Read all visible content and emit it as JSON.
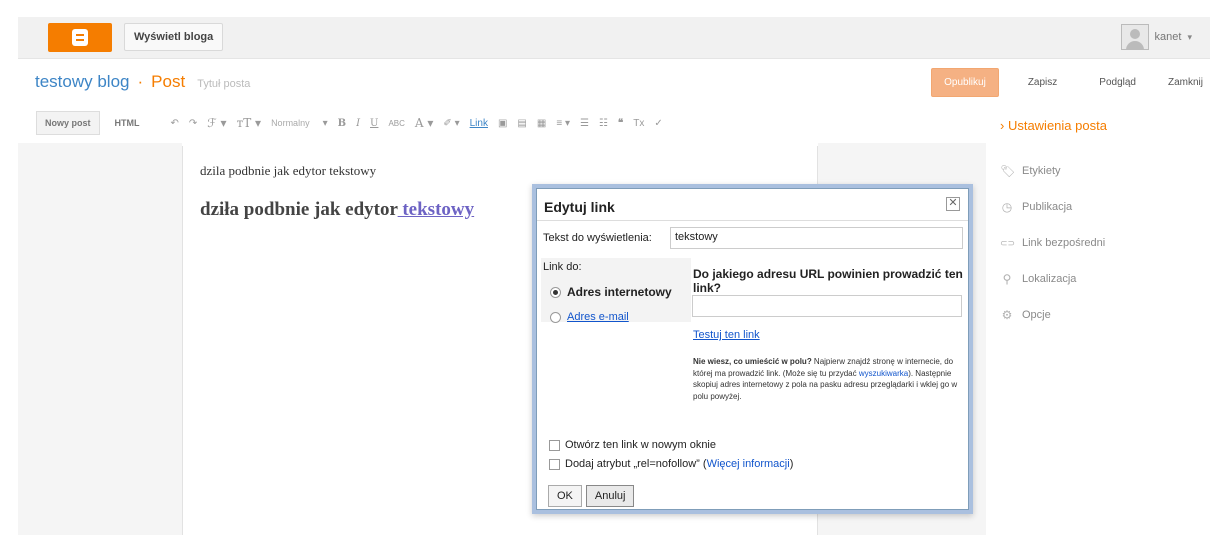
{
  "topbar": {
    "logo_icon": "blogger-logo-icon",
    "view_blog_label": "Wyświetl bloga",
    "user_name": "kanet",
    "user_caret": "▾"
  },
  "header": {
    "blog_name": "testowy blog",
    "separator": "·",
    "post_label": "Post",
    "title_placeholder": "Tytuł posta",
    "publish_label": "Opublikuj",
    "save_label": "Zapisz",
    "preview_label": "Podgląd",
    "close_label": "Zamknij"
  },
  "toolbar": {
    "new_post_label": "Nowy post",
    "html_label": "HTML",
    "undo_icon": "↶",
    "redo_icon": "↷",
    "font_icon": "ℱ ▾",
    "font_size_icon": "тT ▾",
    "format_label": "Normalny",
    "format_caret": "▾",
    "bold": "B",
    "italic": "I",
    "underline": "U",
    "strike": "ABC",
    "text_color": "A ▾",
    "highlight": "✐ ▾",
    "link_label": "Link",
    "image_icon": "▣",
    "video_icon": "▤",
    "jump_icon": "▦",
    "align_icon": "≡ ▾",
    "numbered_list_icon": "☰",
    "bullet_list_icon": "☷",
    "quote_icon": "❝",
    "clear_format_icon": "Tx",
    "spellcheck_icon": "✓"
  },
  "editor": {
    "line1": "dzila podbnie jak edytor tekstowy",
    "line2_prefix": "dziła podbnie jak edytor",
    "line2_link": " tekstowy"
  },
  "sidebar": {
    "heading": "› Ustawienia posta",
    "items": [
      {
        "label": "Etykiety",
        "icon": "🏷"
      },
      {
        "label": "Publikacja",
        "icon": "◷"
      },
      {
        "label": "Link bezpośredni",
        "icon": "⊂⊃"
      },
      {
        "label": "Lokalizacja",
        "icon": "⚲"
      },
      {
        "label": "Opcje",
        "icon": "⚙"
      }
    ]
  },
  "dialog": {
    "title": "Edytuj link",
    "close_icon": "✕",
    "text_label": "Tekst do wyświetlenia:",
    "text_value": "tekstowy",
    "link_to_label": "Link do:",
    "radio_web": "Adres internetowy",
    "radio_email": "Adres e-mail",
    "url_question": "Do jakiego adresu URL powinien prowadzić ten link?",
    "url_value": "",
    "test_link": "Testuj ten link",
    "help_bold": "Nie wiesz, co umieścić w polu?",
    "help_text1": " Najpierw znajdź stronę w internecie, do której ma prowadzić link. (Może się tu przydać ",
    "help_link": "wyszukiwarka",
    "help_text2": "). Następnie skopiuj adres internetowy z pola na pasku adresu przeglądarki i wklej go w polu powyżej.",
    "checkbox_new_window": "Otwórz ten link w nowym oknie",
    "checkbox_nofollow": "Dodaj atrybut „rel=nofollow”",
    "more_info_open": " (",
    "more_info_link": "Więcej informacji",
    "more_info_close": ")",
    "ok_label": "OK",
    "cancel_label": "Anuluj"
  },
  "colors": {
    "accent": "#f57d00",
    "link": "#1155cc",
    "blog_name": "#3d85c6"
  }
}
